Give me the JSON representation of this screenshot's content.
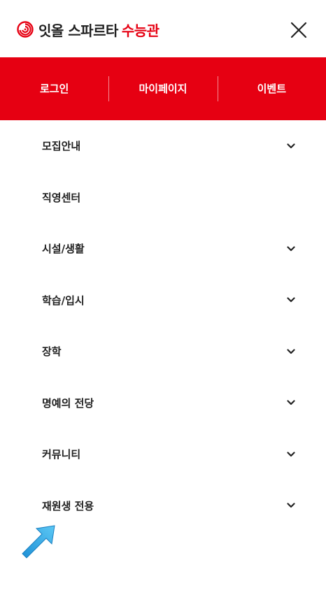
{
  "header": {
    "logo_main": "잇올 스파르타",
    "logo_accent": "수능관"
  },
  "topbar": {
    "items": [
      {
        "label": "로그인"
      },
      {
        "label": "마이페이지"
      },
      {
        "label": "이벤트"
      }
    ]
  },
  "menu": {
    "items": [
      {
        "label": "모집안내",
        "expandable": true
      },
      {
        "label": "직영센터",
        "expandable": false
      },
      {
        "label": "시설/생활",
        "expandable": true
      },
      {
        "label": "학습/입시",
        "expandable": true
      },
      {
        "label": "장학",
        "expandable": true
      },
      {
        "label": "명예의 전당",
        "expandable": true
      },
      {
        "label": "커뮤니티",
        "expandable": true
      },
      {
        "label": "재원생 전용",
        "expandable": true
      }
    ]
  },
  "colors": {
    "brand_red": "#e60012"
  },
  "icons": {
    "logo": "spiral-logo-icon",
    "close": "close-icon",
    "chevron": "chevron-down-icon",
    "pointer": "pointer-arrow-icon"
  }
}
